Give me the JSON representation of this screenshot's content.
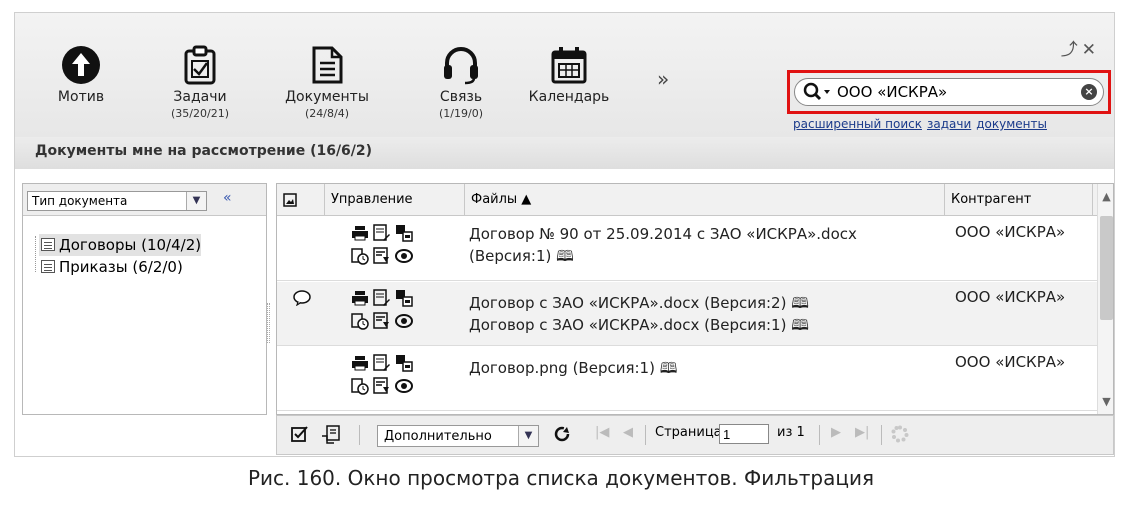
{
  "toolbar": {
    "items": [
      {
        "label": "Мотив",
        "count": "",
        "icon": "arrow-up-circle-icon"
      },
      {
        "label": "Задачи",
        "count": "(35/20/21)",
        "icon": "clipboard-check-icon"
      },
      {
        "label": "Документы",
        "count": "(24/8/4)",
        "icon": "document-icon"
      },
      {
        "label": "Связь",
        "count": "(1/19/0)",
        "icon": "headset-icon"
      },
      {
        "label": "Календарь",
        "count": "",
        "icon": "calendar-icon"
      }
    ],
    "more_symbol": "»",
    "window_controls": "⤴✕"
  },
  "search": {
    "value": "ООО «ИСКРА»",
    "links": [
      "расширенный поиск",
      "задачи",
      "документы"
    ],
    "highlight_color": "#e01212"
  },
  "section_title": "Документы мне на рассмотрение (16/6/2)",
  "filter": {
    "select_value": "Тип документа",
    "collapse_symbol": "«",
    "tree": [
      {
        "label": "Договоры (10/4/2)",
        "selected": true
      },
      {
        "label": "Приказы (6/2/0)",
        "selected": false
      }
    ]
  },
  "grid": {
    "columns": [
      "Управление",
      "Файлы ▲",
      "Контрагент"
    ],
    "rows": [
      {
        "comment": false,
        "files": [
          "Договор № 90 от 25.09.2014 с ЗАО «ИСКРА».docx",
          "(Версия:1) 🕮"
        ],
        "agent": "ООО «ИСКРА»"
      },
      {
        "comment": true,
        "files": [
          "Договор с ЗАО «ИСКРА».docx (Версия:2) 🕮",
          "Договор с ЗАО «ИСКРА».docx (Версия:1) 🕮"
        ],
        "agent": "ООО «ИСКРА»"
      },
      {
        "comment": false,
        "files": [
          "Договор.png (Версия:1) 🕮",
          ""
        ],
        "agent": "ООО «ИСКРА»"
      }
    ]
  },
  "pager": {
    "action_value": "Дополнительно",
    "page_label": "Страница",
    "page_value": "1",
    "of_label": "из 1"
  },
  "caption": "Рис. 160. Окно просмотра списка документов. Фильтрация"
}
